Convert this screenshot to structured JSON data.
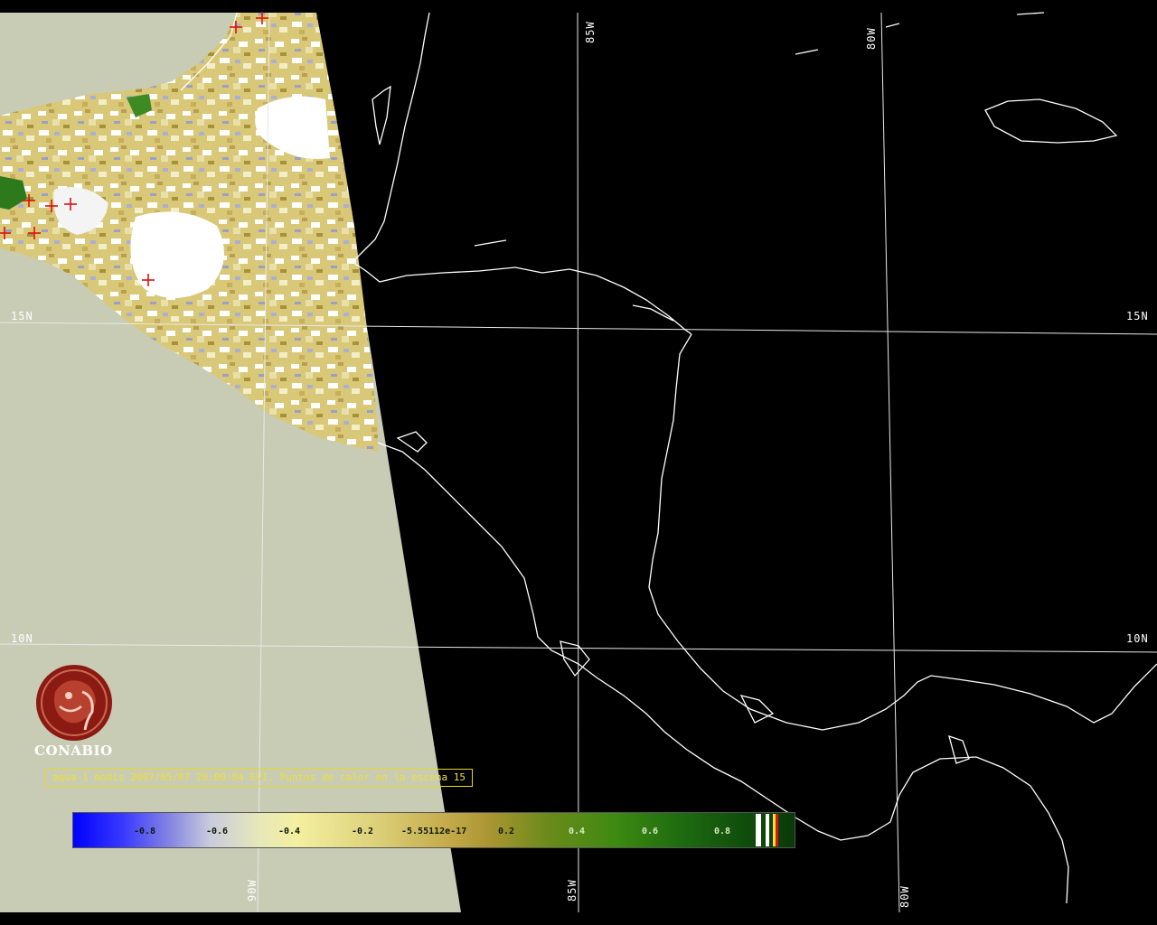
{
  "map": {
    "grid_labels": {
      "lat_15_left": "15N",
      "lat_15_right": "15N",
      "lat_10_left": "10N",
      "lat_10_right": "10N",
      "lon_85_top": "85W",
      "lon_80_top": "80W",
      "lon_90_bottom": "90W",
      "lon_85_bottom": "85W",
      "lon_80_bottom": "80W"
    },
    "colors": {
      "no_data": "#c8ccb4",
      "background": "#000000",
      "coastline": "#ffffff",
      "hotspot_marker": "#dd1010",
      "caption_text": "#f0e030",
      "logo": "#8b1a12"
    }
  },
  "logo": {
    "name": "conabio-logo",
    "text": "CONABIO"
  },
  "caption": {
    "text": "aqua-1 modis 2007/05/07 20:00:04 EVI, Puntos de calor en la escena 15"
  },
  "colorbar": {
    "ticks": [
      "-0.8",
      "-0.6",
      "-0.4",
      "-0.2",
      "-5.55112e-17",
      "0.2",
      "0.4",
      "0.6",
      "0.8"
    ]
  }
}
